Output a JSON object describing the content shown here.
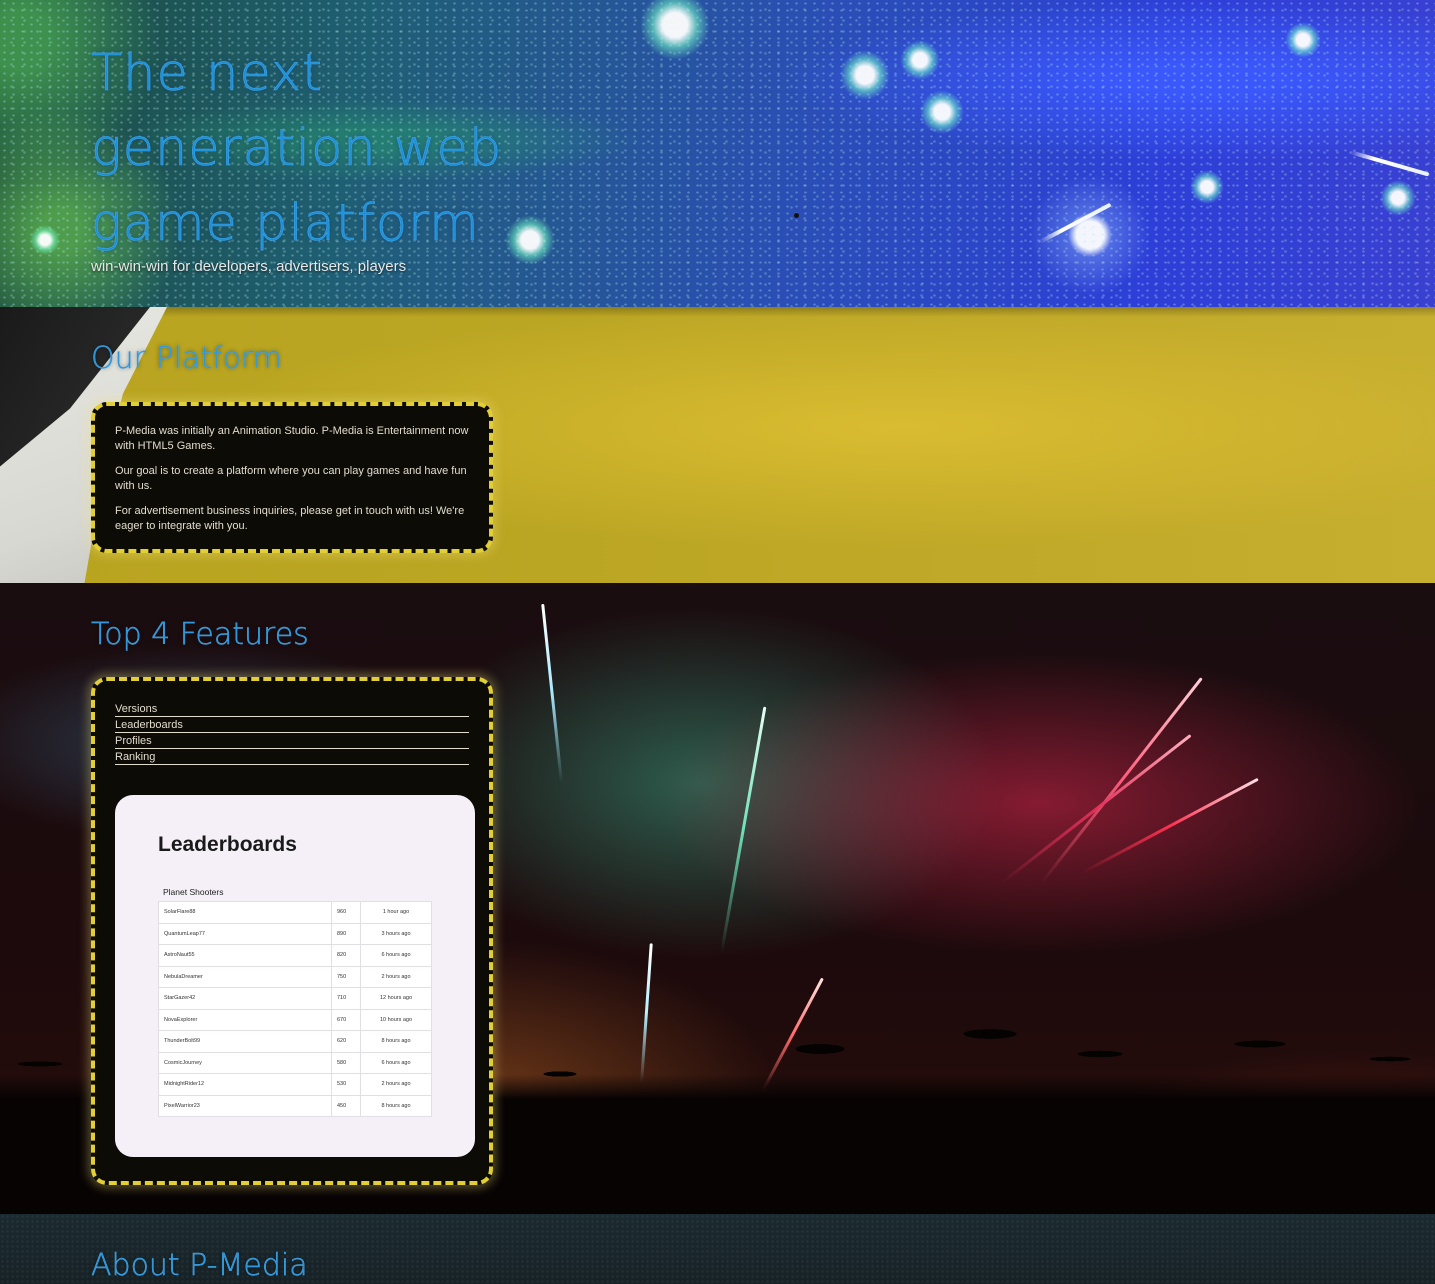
{
  "hero": {
    "title": "The next generation web game platform",
    "subtitle": "win-win-win for developers, advertisers, players"
  },
  "platform": {
    "heading": "Our Platform",
    "paragraphs": [
      "P-Media was initially an Animation Studio. P-Media is Entertainment now with HTML5 Games.",
      "Our goal is to create a platform where you can play games and have fun with us.",
      "For advertisement business inquiries, please get in touch with us! We're eager to integrate with you."
    ]
  },
  "features": {
    "heading": "Top 4 Features",
    "items": [
      "Versions",
      "Leaderboards",
      "Profiles",
      "Ranking"
    ],
    "preview": {
      "title": "Leaderboards",
      "game": "Planet Shooters",
      "rows": [
        {
          "player": "SolarFlare88",
          "score": "960",
          "time": "1 hour ago"
        },
        {
          "player": "QuantumLeap77",
          "score": "890",
          "time": "3 hours ago"
        },
        {
          "player": "AstroNaut55",
          "score": "820",
          "time": "6 hours ago"
        },
        {
          "player": "NebulaDreamer",
          "score": "750",
          "time": "2 hours ago"
        },
        {
          "player": "StarGazer42",
          "score": "710",
          "time": "12 hours ago"
        },
        {
          "player": "NovaExplorer",
          "score": "670",
          "time": "10 hours ago"
        },
        {
          "player": "ThunderBolt99",
          "score": "620",
          "time": "8 hours ago"
        },
        {
          "player": "CosmicJourney",
          "score": "580",
          "time": "6 hours ago"
        },
        {
          "player": "MidnightRider12",
          "score": "530",
          "time": "2 hours ago"
        },
        {
          "player": "PixelWarrior23",
          "score": "450",
          "time": "8 hours ago"
        }
      ]
    }
  },
  "about": {
    "heading": "About P-Media"
  },
  "colors": {
    "heading_blue": "#2693d9",
    "card_border_yellow": "#e2cf35",
    "card_background": "#0d0b05"
  }
}
